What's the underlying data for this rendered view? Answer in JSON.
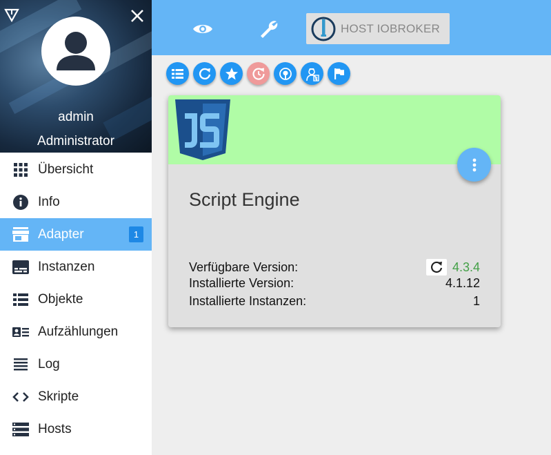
{
  "user": {
    "name": "admin",
    "role": "Administrator"
  },
  "sidebar": {
    "items": [
      {
        "label": "Übersicht",
        "icon": "grid-icon"
      },
      {
        "label": "Info",
        "icon": "info-icon"
      },
      {
        "label": "Adapter",
        "icon": "store-icon",
        "badge": "1",
        "active": true
      },
      {
        "label": "Instanzen",
        "icon": "subtitles-icon"
      },
      {
        "label": "Objekte",
        "icon": "list-icon"
      },
      {
        "label": "Aufzählungen",
        "icon": "contact-card-icon"
      },
      {
        "label": "Log",
        "icon": "lines-icon"
      },
      {
        "label": "Skripte",
        "icon": "code-icon"
      },
      {
        "label": "Hosts",
        "icon": "storage-icon"
      }
    ]
  },
  "topbar": {
    "host_label": "HOST IOBROKER",
    "icons": [
      "eye-icon",
      "wrench-icon",
      "iobroker-logo-icon"
    ]
  },
  "toolbar": {
    "buttons": [
      "list-view-icon",
      "refresh-icon",
      "star-icon",
      "update-icon",
      "github-icon",
      "expert-icon",
      "flag-icon"
    ]
  },
  "adapter_card": {
    "title": "Script Engine",
    "logo": "javascript-logo",
    "available_label": "Verfügbare Version:",
    "available_value": "4.3.4",
    "installed_label": "Installierte Version:",
    "installed_value": "4.1.12",
    "instances_label": "Installierte Instanzen:",
    "instances_value": "1"
  },
  "colors": {
    "primary": "#64b5f6",
    "button": "#2196f3",
    "card_header": "#b0fca6",
    "version_green": "#43a047",
    "disabled_button": "#ef9a9a"
  }
}
